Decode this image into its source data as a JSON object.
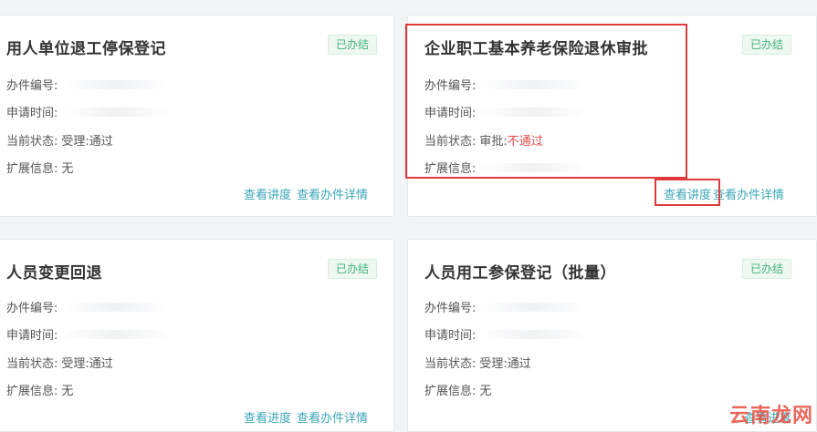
{
  "cards": [
    {
      "title": "用人单位退工停保登记",
      "status_badge": "已办结",
      "fields": [
        {
          "label": "办件编号:",
          "value": ""
        },
        {
          "label": "申请时间:",
          "value": ""
        },
        {
          "label": "当前状态:",
          "value": "受理:通过"
        },
        {
          "label": "扩展信息:",
          "value": "无"
        }
      ],
      "actions": [
        "查看讲度",
        "查看办件详情"
      ]
    },
    {
      "title": "企业职工基本养老保险退休审批",
      "status_badge": "已办结",
      "fields": [
        {
          "label": "办件编号:",
          "value": ""
        },
        {
          "label": "申请时间:",
          "value": ""
        },
        {
          "label": "当前状态:",
          "value_prefix": "审批:",
          "value_highlight": "不通过"
        },
        {
          "label": "扩展信息:",
          "value": ""
        }
      ],
      "actions": [
        "查看讲度",
        "查看办件详情"
      ]
    },
    {
      "title": "人员变更回退",
      "status_badge": "已办结",
      "fields": [
        {
          "label": "办件编号:",
          "value": ""
        },
        {
          "label": "申请时间:",
          "value": ""
        },
        {
          "label": "当前状态:",
          "value": "受理:通过"
        },
        {
          "label": "扩展信息:",
          "value": "无"
        }
      ],
      "actions": [
        "查看进度",
        "查看办件详情"
      ]
    },
    {
      "title": "人员用工参保登记（批量）",
      "status_badge": "已办结",
      "fields": [
        {
          "label": "办件编号:",
          "value": ""
        },
        {
          "label": "申请时间:",
          "value": ""
        },
        {
          "label": "当前状态:",
          "value": "受理:通过"
        },
        {
          "label": "扩展信息:",
          "value": "无"
        }
      ],
      "actions": [
        "查看进度"
      ]
    }
  ],
  "watermark": "云南龙网",
  "colors": {
    "badge_text": "#43b37a",
    "link": "#3aa6b9",
    "rejected": "#e5484d",
    "highlight_box": "#e03a3a"
  }
}
